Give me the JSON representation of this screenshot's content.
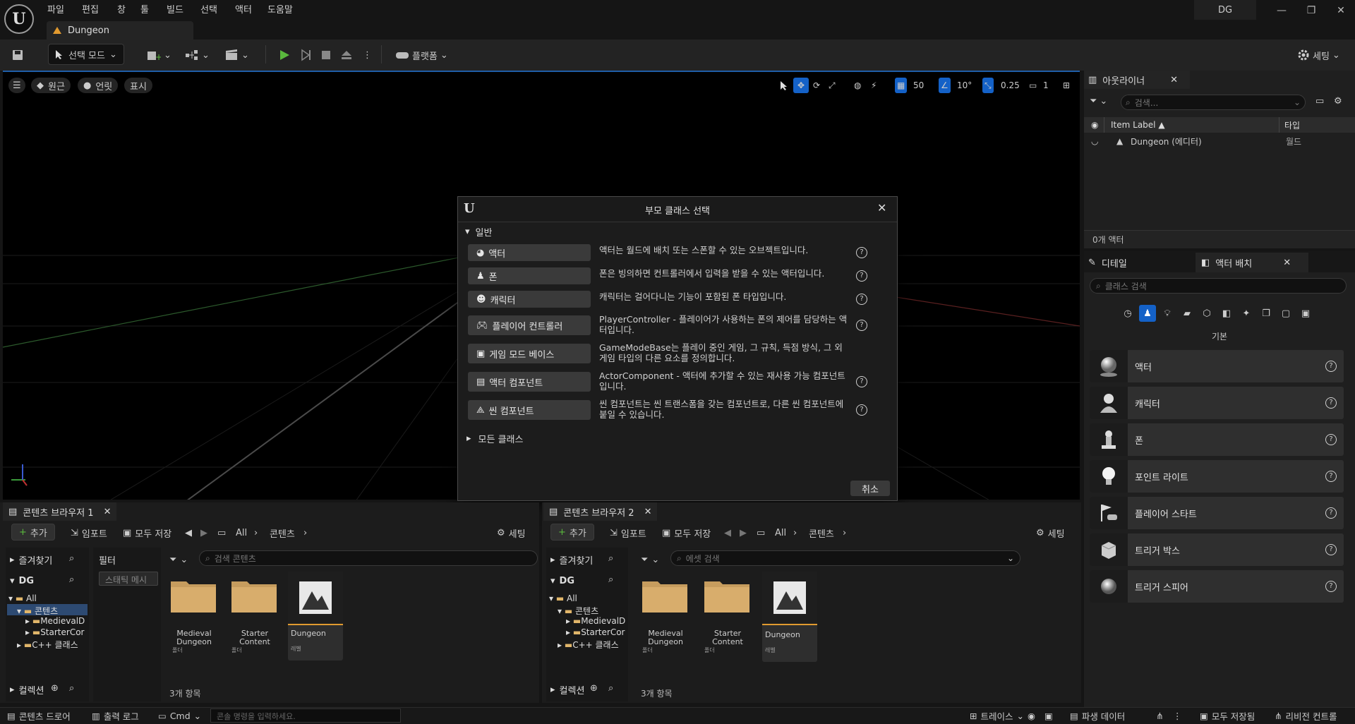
{
  "menu": [
    "파일",
    "편집",
    "창",
    "툴",
    "빌드",
    "선택",
    "액터",
    "도움말"
  ],
  "title_badge": "DG",
  "document_tab": "Dungeon",
  "toolbar": {
    "select_mode": "선택 모드",
    "platform": "플랫폼",
    "settings": "세팅"
  },
  "viewport": {
    "perspective": "원근",
    "lit": "언릿",
    "show": "표시",
    "grid_size": "50",
    "rotation_snap": "10°",
    "scale_snap": "0.25",
    "camera_speed": "1"
  },
  "dialog": {
    "title": "부모 클래스 선택",
    "section_common": "일반",
    "items": [
      {
        "label": "액터",
        "desc": "액터는 월드에 배치 또는 스폰할 수 있는 오브젝트입니다."
      },
      {
        "label": "폰",
        "desc": "폰은 빙의하면 컨트롤러에서 입력을 받을 수 있는 액터입니다."
      },
      {
        "label": "캐릭터",
        "desc": "캐릭터는 걸어다니는 기능이 포함된 폰 타입입니다."
      },
      {
        "label": "플레이어 컨트롤러",
        "desc": "PlayerController - 플레이어가 사용하는 폰의 제어를 담당하는 액터입니다."
      },
      {
        "label": "게임 모드 베이스",
        "desc": "GameModeBase는 플레이 중인 게임, 그 규칙, 득점 방식, 그 외 게임 타입의 다른 요소를 정의합니다."
      },
      {
        "label": "액터 컴포넌트",
        "desc": "ActorComponent - 액터에 추가할 수 있는 재사용 가능 컴포넌트입니다."
      },
      {
        "label": "씬 컴포넌트",
        "desc": "씬 컴포넌트는 씬 트랜스폼을 갖는 컴포넌트로, 다른 씬 컴포넌트에 붙일 수 있습니다."
      }
    ],
    "section_all": "모든 클래스",
    "cancel": "취소"
  },
  "outliner": {
    "tab": "아웃라이너",
    "search_placeholder": "검색...",
    "col_label": "Item Label ▲",
    "col_type": "타입",
    "rows": [
      {
        "label": "Dungeon (에디터)",
        "type": "월드"
      }
    ],
    "count": "0개 액터"
  },
  "place_actors": {
    "tab_details": "디테일",
    "tab_place": "액터 배치",
    "search_placeholder": "클래스 검색",
    "category": "기본",
    "items": [
      "액터",
      "캐릭터",
      "폰",
      "포인트 라이트",
      "플레이어 스타트",
      "트리거 박스",
      "트리거 스피어"
    ]
  },
  "cb1": {
    "tab": "콘텐츠 브라우저 1",
    "add": "추가",
    "import": "임포트",
    "save_all": "모두 저장",
    "path_all": "All",
    "path_content": "콘텐츠",
    "settings": "세팅",
    "favorites": "즐겨찾기",
    "project": "DG",
    "filter": "필터",
    "filter_chip": "스태틱 메시",
    "search_placeholder": "검색 콘텐츠",
    "tree": [
      "All",
      "콘텐츠",
      "MedievalD",
      "StarterCor",
      "C++ 클래스"
    ],
    "collections": "컬렉션",
    "assets": [
      {
        "name": "Medieval Dungeon",
        "type": "폴더"
      },
      {
        "name": "Starter Content",
        "type": "폴더"
      },
      {
        "name": "Dungeon",
        "type": "레벨"
      }
    ],
    "count": "3개 항목"
  },
  "cb2": {
    "tab": "콘텐츠 브라우저 2",
    "add": "추가",
    "import": "임포트",
    "save_all": "모두 저장",
    "path_all": "All",
    "path_content": "콘텐츠",
    "settings": "세팅",
    "favorites": "즐겨찾기",
    "project": "DG",
    "search_placeholder": "에셋 검색",
    "tree": [
      "All",
      "콘텐츠",
      "MedievalD",
      "StarterCor",
      "C++ 클래스"
    ],
    "collections": "컬렉션",
    "assets": [
      {
        "name": "Medieval Dungeon",
        "type": "폴더"
      },
      {
        "name": "Starter Content",
        "type": "폴더"
      },
      {
        "name": "Dungeon",
        "type": "레벨"
      }
    ],
    "count": "3개 항목"
  },
  "statusbar": {
    "content_drawer": "콘텐츠 드로어",
    "output_log": "출력 로그",
    "cmd": "Cmd",
    "console_placeholder": "콘솔 명령을 입력하세요.",
    "trace": "트레이스",
    "derived_data": "파생 데이터",
    "save_all": "모두 저장됨",
    "revision": "리비전 컨트롤"
  },
  "colors": {
    "accent": "#1461c7",
    "play": "#5ab93d",
    "level_underline": "#e19a2f"
  }
}
